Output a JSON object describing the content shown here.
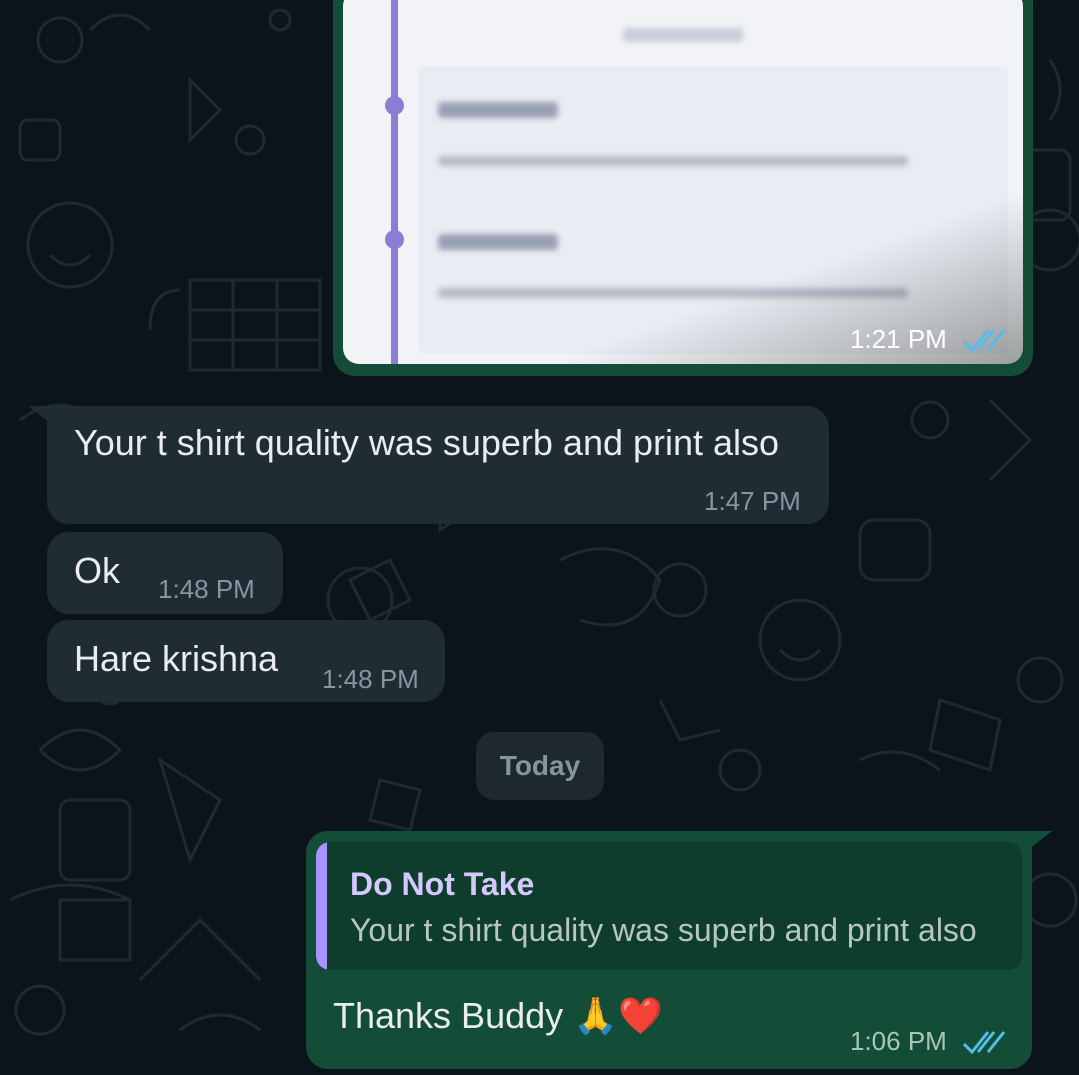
{
  "image_message": {
    "date_blurred": "31 Jan 2023",
    "entries": [
      {
        "status": "In Transit",
        "detail": "SKLVH BARBAN, AHAVAREG, TSIL-ARD, SHRFGGG"
      },
      {
        "status": "In Transit",
        "detail": "SKLVH BARBAN, AHAVAREG, TSIL-ARD, SHRFGGG"
      }
    ],
    "time": "1:21 PM"
  },
  "messages": [
    {
      "text": "Your t shirt quality was superb and print also",
      "time": "1:47 PM"
    },
    {
      "text": "Ok",
      "time": "1:48 PM"
    },
    {
      "text": "Hare krishna",
      "time": "1:48 PM"
    }
  ],
  "date_separator": "Today",
  "reply": {
    "quoted_author": "Do Not Take",
    "quoted_text": "Your t shirt quality was superb and print also",
    "text": "Thanks Buddy 🙏❤️",
    "time": "1:06 PM"
  },
  "colors": {
    "incoming_bubble": "#202c33",
    "outgoing_bubble": "#144d37",
    "read_ticks": "#53bdeb",
    "quote_accent": "#a794ff"
  }
}
